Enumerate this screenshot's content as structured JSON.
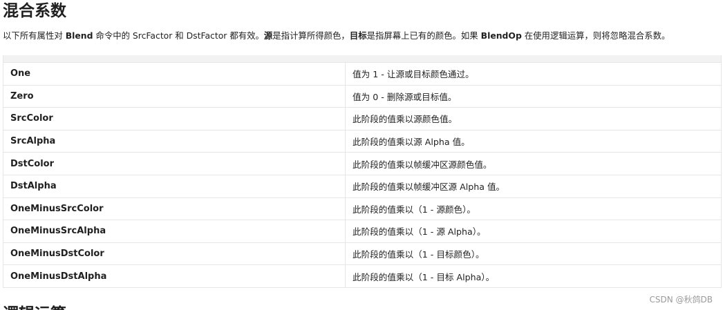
{
  "title": "混合系数",
  "description": {
    "p1": "以下所有属性对 ",
    "b1": "Blend",
    "p2": " 命令中的 SrcFactor 和 DstFactor 都有效。",
    "b2": "源",
    "p3": "是指计算所得颜色，",
    "b3": "目标",
    "p4": "是指屏幕上已有的颜色。如果 ",
    "b4": "BlendOp",
    "p5": " 在使用逻辑运算，则将忽略混合系数。"
  },
  "rows": [
    {
      "name": "One",
      "desc": "值为 1 - 让源或目标颜色通过。"
    },
    {
      "name": "Zero",
      "desc": "值为 0 - 删除源或目标值。"
    },
    {
      "name": "SrcColor",
      "desc": "此阶段的值乘以源颜色值。"
    },
    {
      "name": "SrcAlpha",
      "desc": "此阶段的值乘以源 Alpha 值。"
    },
    {
      "name": "DstColor",
      "desc": "此阶段的值乘以帧缓冲区源颜色值。"
    },
    {
      "name": "DstAlpha",
      "desc": "此阶段的值乘以帧缓冲区源 Alpha 值。"
    },
    {
      "name": "OneMinusSrcColor",
      "desc": "此阶段的值乘以（1 - 源颜色）。"
    },
    {
      "name": "OneMinusSrcAlpha",
      "desc": "此阶段的值乘以（1 - 源 Alpha）。"
    },
    {
      "name": "OneMinusDstColor",
      "desc": "此阶段的值乘以（1 - 目标颜色）。"
    },
    {
      "name": "OneMinusDstAlpha",
      "desc": "此阶段的值乘以（1 - 目标 Alpha）。"
    }
  ],
  "next_heading": "逻辑运算",
  "watermark": "CSDN @秋鸽DB"
}
